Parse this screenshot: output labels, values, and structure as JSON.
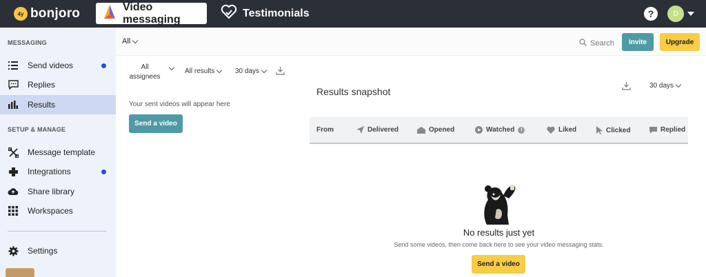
{
  "topbar": {
    "logo_text": "bonjoro",
    "logo_mark": "4y",
    "nav_video_messaging": "Video messaging",
    "nav_testimonials": "Testimonials",
    "help_symbol": "?",
    "avatar_initial": "D",
    "icons": [
      "bonjoro-logo-icon",
      "video-messaging-icon",
      "testimonials-icon",
      "help-icon",
      "avatar",
      "caret-down-icon"
    ]
  },
  "sidebar": {
    "section_messaging": "MESSAGING",
    "section_setup": "SETUP & MANAGE",
    "items": [
      {
        "label": "Send videos",
        "icon": "list-icon",
        "dot": true
      },
      {
        "label": "Replies",
        "icon": "chat-icon",
        "dot": false
      },
      {
        "label": "Results",
        "icon": "bar-chart-icon",
        "dot": false,
        "active": true
      },
      {
        "label": "Message template",
        "icon": "template-icon",
        "dot": false
      },
      {
        "label": "Integrations",
        "icon": "puzzle-icon",
        "dot": true
      },
      {
        "label": "Share library",
        "icon": "cloud-icon",
        "dot": false
      },
      {
        "label": "Workspaces",
        "icon": "grid-icon",
        "dot": false
      },
      {
        "label": "Settings",
        "icon": "gear-icon",
        "dot": false
      }
    ]
  },
  "filterbar": {
    "all_label": "All",
    "search_label": "Search",
    "invite_label": "Invite",
    "upgrade_label": "Upgrade"
  },
  "left_panel": {
    "assignees_label": "All assignees",
    "results_label": "All results",
    "days_label": "30 days",
    "empty_text": "Your sent videos will appear here",
    "send_button": "Send a video"
  },
  "right_panel": {
    "title": "Results snapshot",
    "days_label": "30 days",
    "columns": [
      "From",
      "Delivered",
      "Opened",
      "Watched",
      "Liked",
      "Clicked",
      "Replied"
    ],
    "empty_title": "No results just yet",
    "empty_sub": "Send some videos, then come back here to see your video messaging stats.",
    "send_button": "Send a video"
  },
  "colors": {
    "topbar": "#2b2f38",
    "sidebar": "#eef3fb",
    "sidebar_active": "#cdd8f2",
    "teal": "#4f9aa5",
    "yellow": "#f8cc45",
    "dot_blue": "#1f4fe0"
  }
}
